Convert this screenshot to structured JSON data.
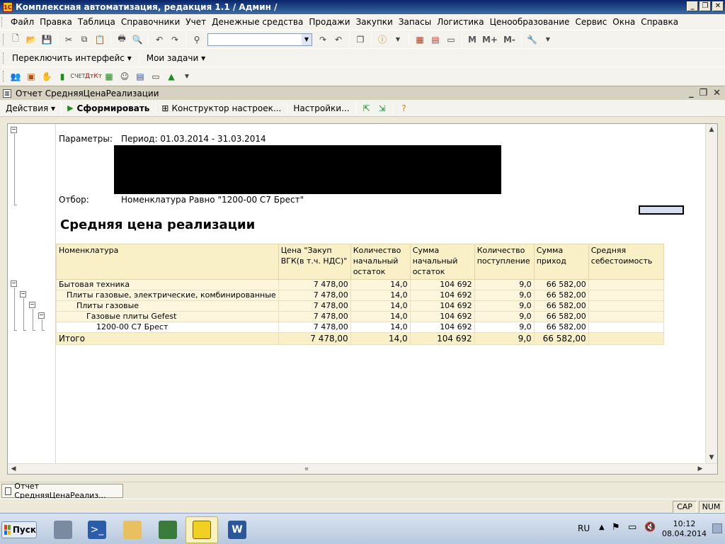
{
  "window": {
    "title": "Комплексная автоматизация, редакция 1.1 / Админ /"
  },
  "menu": [
    "Файл",
    "Правка",
    "Таблица",
    "Справочники",
    "Учет",
    "Денежные средства",
    "Продажи",
    "Закупки",
    "Запасы",
    "Логистика",
    "Ценообразование",
    "Сервис",
    "Окна",
    "Справка"
  ],
  "toolbar2": {
    "switch_interface": "Переключить интерфейс",
    "my_tasks": "Мои задачи"
  },
  "toolbar1": {
    "m": "M",
    "m_plus": "M+",
    "m_minus": "M-"
  },
  "document": {
    "title": "Отчет  СредняяЦенаРеализации"
  },
  "actions": {
    "actions": "Действия",
    "generate": "Сформировать",
    "constructor": "Конструктор настроек...",
    "settings": "Настройки..."
  },
  "report": {
    "params_label": "Параметры:",
    "params_value": "Период: 01.03.2014 - 31.03.2014",
    "filter_label": "Отбор:",
    "filter_value": "Номенклатура Равно \"1200-00 С7 Брест\"",
    "title": "Средняя цена реализации",
    "headers": [
      "Номенклатура",
      "Цена \"Закуп ВГК(в т.ч. НДС)\"",
      "Количество начальный остаток",
      "Сумма начальный остаток",
      "Количество поступление",
      "Сумма приход",
      "Средняя себестоимость"
    ],
    "rows": [
      {
        "name": "Бытовая техника",
        "price": "7 478,00",
        "qty_start": "14,0",
        "sum_start": "104 692",
        "qty_in": "9,0",
        "sum_in": "66 582,00",
        "avg_cost": ""
      },
      {
        "name": "Плиты газовые, электрические, комбинированные",
        "price": "7 478,00",
        "qty_start": "14,0",
        "sum_start": "104 692",
        "qty_in": "9,0",
        "sum_in": "66 582,00",
        "avg_cost": ""
      },
      {
        "name": "Плиты газовые",
        "price": "7 478,00",
        "qty_start": "14,0",
        "sum_start": "104 692",
        "qty_in": "9,0",
        "sum_in": "66 582,00",
        "avg_cost": ""
      },
      {
        "name": "Газовые плиты Gefest",
        "price": "7 478,00",
        "qty_start": "14,0",
        "sum_start": "104 692",
        "qty_in": "9,0",
        "sum_in": "66 582,00",
        "avg_cost": ""
      },
      {
        "name": "1200-00 С7 Брест",
        "price": "7 478,00",
        "qty_start": "14,0",
        "sum_start": "104 692",
        "qty_in": "9,0",
        "sum_in": "66 582,00",
        "avg_cost": ""
      }
    ],
    "total": {
      "name": "Итого",
      "price": "7 478,00",
      "qty_start": "14,0",
      "sum_start": "104 692",
      "qty_in": "9,0",
      "sum_in": "66 582,00",
      "avg_cost": ""
    }
  },
  "tabbar": {
    "tab": "Отчет  СредняяЦенаРеализ..."
  },
  "status": {
    "cap": "CAP",
    "num": "NUM"
  },
  "taskbar": {
    "start": "Пуск",
    "lang": "RU",
    "time": "10:12",
    "date": "08.04.2014"
  },
  "colors": {
    "header_bg": "#faf0c8",
    "group_row_bg": "#fdf6dc",
    "title_gradient_start": "#0a246a",
    "generate_icon": "#1c8a1c"
  }
}
